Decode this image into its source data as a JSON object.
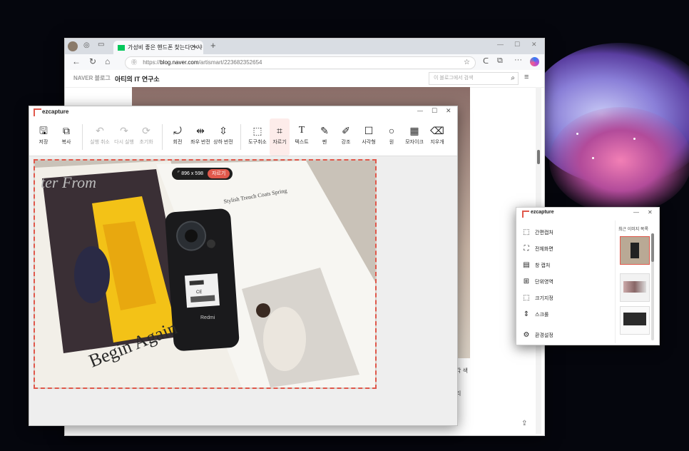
{
  "browser": {
    "tab_title": "가성비 좋은 핸드폰 찾는다면 샤오",
    "url_prefix": "https://",
    "url_host": "blog.naver.com",
    "url_path": "/artismart/223682352654",
    "blog_brand": "NAVER 블로그",
    "blog_name": "아티의 IT 연구소",
    "search_placeholder": "이 블로그에서 검색",
    "side_text_1": "각 색",
    "side_text_2": "리"
  },
  "editor": {
    "app_name": "ezcapture",
    "tools": [
      {
        "id": "save",
        "label": "저장",
        "icon": "save-icon",
        "enabled": true
      },
      {
        "id": "copy",
        "label": "복사",
        "icon": "copy-icon",
        "enabled": true
      },
      {
        "id": "undo",
        "label": "실행 취소",
        "icon": "undo-icon",
        "enabled": false
      },
      {
        "id": "redo",
        "label": "다시 실행",
        "icon": "redo-icon",
        "enabled": false
      },
      {
        "id": "reset",
        "label": "초기화",
        "icon": "reset-icon",
        "enabled": false
      },
      {
        "id": "rotate",
        "label": "회전",
        "icon": "rotate-icon",
        "enabled": true
      },
      {
        "id": "flip_h",
        "label": "좌우 반전",
        "icon": "flip-horizontal-icon",
        "enabled": true
      },
      {
        "id": "flip_v",
        "label": "상하 반전",
        "icon": "flip-vertical-icon",
        "enabled": true
      },
      {
        "id": "cancel",
        "label": "도구취소",
        "icon": "cancel-tool-icon",
        "enabled": true
      },
      {
        "id": "crop",
        "label": "자르기",
        "icon": "crop-icon",
        "enabled": true,
        "active": true
      },
      {
        "id": "text",
        "label": "텍스트",
        "icon": "text-icon",
        "enabled": true
      },
      {
        "id": "pen",
        "label": "펜",
        "icon": "pen-icon",
        "enabled": true
      },
      {
        "id": "highlight",
        "label": "강조",
        "icon": "highlighter-icon",
        "enabled": true
      },
      {
        "id": "rect",
        "label": "사각형",
        "icon": "rectangle-icon",
        "enabled": true
      },
      {
        "id": "circle",
        "label": "원",
        "icon": "circle-icon",
        "enabled": true
      },
      {
        "id": "mosaic",
        "label": "모자이크",
        "icon": "mosaic-icon",
        "enabled": true
      },
      {
        "id": "eraser",
        "label": "지우개",
        "icon": "eraser-icon",
        "enabled": true
      }
    ],
    "crop_size": "896 x 598",
    "crop_button": "자르기",
    "photo_texts": {
      "magazine_top": "ter From",
      "magazine_bottom": "Begin Again",
      "article_head": "Stylish Trench Coats Spring",
      "phone_brand": "Redmi",
      "phone_cert": "CE"
    }
  },
  "mini": {
    "app_name": "ezcapture",
    "items": [
      {
        "label": "간편캡처",
        "icon": "region-capture-icon"
      },
      {
        "label": "전체화면",
        "icon": "fullscreen-capture-icon"
      },
      {
        "label": "창 캡처",
        "icon": "window-capture-icon"
      },
      {
        "label": "단위영역",
        "icon": "unit-region-icon"
      },
      {
        "label": "크기지정",
        "icon": "size-capture-icon"
      },
      {
        "label": "스크롤",
        "icon": "scroll-capture-icon"
      }
    ],
    "settings": "환경설정",
    "recent_title": "최근 이미지 목록",
    "colors": {
      "accent": "#e0584b"
    }
  }
}
